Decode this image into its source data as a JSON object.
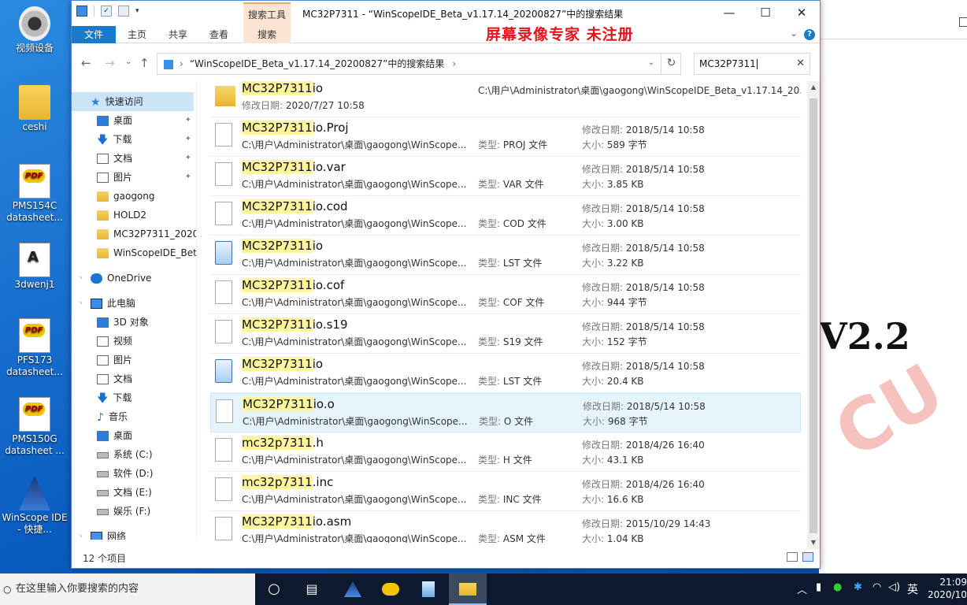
{
  "desktop": {
    "icons": [
      {
        "label": "视频设备",
        "type": "camera"
      },
      {
        "label": "ceshi",
        "type": "folder"
      },
      {
        "label": "PMS154C datasheet...",
        "type": "pdf"
      },
      {
        "label": "3dwenj1",
        "type": "doc"
      },
      {
        "label": "PFS173 datasheet...",
        "type": "pdf"
      },
      {
        "label": "PMS150G datasheet ...",
        "type": "pdf"
      },
      {
        "label": "WinScope IDE - 快捷...",
        "type": "winscope"
      }
    ]
  },
  "right_window": {
    "text": "V2.2"
  },
  "explorer": {
    "title": "MC32P7311 - “WinScopeIDE_Beta_v1.17.14_20200827”中的搜索结果",
    "context_tab": "搜索工具",
    "ribbon_tabs": [
      "文件",
      "主页",
      "共享",
      "查看",
      "搜索"
    ],
    "watermark": "屏幕录像专家  未注册",
    "address": "“WinScopeIDE_Beta_v1.17.14_20200827”中的搜索结果",
    "search_value": "MC32P7311",
    "nav": [
      {
        "label": "快速访问",
        "icon": "star",
        "selected": true,
        "pinned": false
      },
      {
        "label": "桌面",
        "icon": "blue",
        "pinned": true
      },
      {
        "label": "下载",
        "icon": "down",
        "pinned": true
      },
      {
        "label": "文档",
        "icon": "doc",
        "pinned": true
      },
      {
        "label": "图片",
        "icon": "doc",
        "pinned": true
      },
      {
        "label": "gaogong",
        "icon": "folder"
      },
      {
        "label": "HOLD2",
        "icon": "folder"
      },
      {
        "label": "MC32P7311_2020",
        "icon": "folder"
      },
      {
        "label": "WinScopeIDE_Bet",
        "icon": "folder"
      },
      {
        "label": "OneDrive",
        "icon": "cloud"
      },
      {
        "label": "此电脑",
        "icon": "pc"
      },
      {
        "label": "3D 对象",
        "icon": "blue"
      },
      {
        "label": "视频",
        "icon": "doc"
      },
      {
        "label": "图片",
        "icon": "doc"
      },
      {
        "label": "文档",
        "icon": "doc"
      },
      {
        "label": "下载",
        "icon": "down"
      },
      {
        "label": "音乐",
        "icon": "music"
      },
      {
        "label": "桌面",
        "icon": "blue"
      },
      {
        "label": "系统 (C:)",
        "icon": "drive"
      },
      {
        "label": "软件 (D:)",
        "icon": "drive"
      },
      {
        "label": "文档 (E:)",
        "icon": "drive"
      },
      {
        "label": "娱乐 (F:)",
        "icon": "drive"
      },
      {
        "label": "网络",
        "icon": "net"
      }
    ],
    "labels": {
      "type": "类型:",
      "modified": "修改日期:",
      "size": "大小:"
    },
    "files": [
      {
        "hl": "MC32P7311",
        "rest": "io",
        "icon": "folder",
        "path": "C:\\用户\\Administrator\\桌面\\gaogong\\WinScopeIDE_Beta_v1.17.14_20...",
        "type": "",
        "modified": "2020/7/27 10:58",
        "size": "",
        "is_folder": true
      },
      {
        "hl": "MC32P7311",
        "rest": "io.Proj",
        "icon": "file",
        "path": "C:\\用户\\Administrator\\桌面\\gaogong\\WinScope...",
        "type": "PROJ 文件",
        "modified": "2018/5/14 10:58",
        "size": "589 字节"
      },
      {
        "hl": "MC32P7311",
        "rest": "io.var",
        "icon": "file",
        "path": "C:\\用户\\Administrator\\桌面\\gaogong\\WinScope...",
        "type": "VAR 文件",
        "modified": "2018/5/14 10:58",
        "size": "3.85 KB"
      },
      {
        "hl": "MC32P7311",
        "rest": "io.cod",
        "icon": "file",
        "path": "C:\\用户\\Administrator\\桌面\\gaogong\\WinScope...",
        "type": "COD 文件",
        "modified": "2018/5/14 10:58",
        "size": "3.00 KB"
      },
      {
        "hl": "MC32P7311",
        "rest": "io",
        "icon": "notepad",
        "path": "C:\\用户\\Administrator\\桌面\\gaogong\\WinScope...",
        "type": "LST 文件",
        "modified": "2018/5/14 10:58",
        "size": "3.22 KB"
      },
      {
        "hl": "MC32P7311",
        "rest": "io.cof",
        "icon": "file",
        "path": "C:\\用户\\Administrator\\桌面\\gaogong\\WinScope...",
        "type": "COF 文件",
        "modified": "2018/5/14 10:58",
        "size": "944 字节"
      },
      {
        "hl": "MC32P7311",
        "rest": "io.s19",
        "icon": "file",
        "path": "C:\\用户\\Administrator\\桌面\\gaogong\\WinScope...",
        "type": "S19 文件",
        "modified": "2018/5/14 10:58",
        "size": "152 字节"
      },
      {
        "hl": "MC32P7311",
        "rest": "io",
        "icon": "notepad",
        "path": "C:\\用户\\Administrator\\桌面\\gaogong\\WinScope...",
        "type": "LST 文件",
        "modified": "2018/5/14 10:58",
        "size": "20.4 KB"
      },
      {
        "hl": "MC32P7311",
        "rest": "io.o",
        "icon": "file",
        "path": "C:\\用户\\Administrator\\桌面\\gaogong\\WinScope...",
        "type": "O 文件",
        "modified": "2018/5/14 10:58",
        "size": "968 字节",
        "hover": true
      },
      {
        "hl": "mc32p7311",
        "rest": ".h",
        "icon": "file",
        "path": "C:\\用户\\Administrator\\桌面\\gaogong\\WinScope...",
        "type": "H 文件",
        "modified": "2018/4/26 16:40",
        "size": "43.1 KB"
      },
      {
        "hl": "mc32p7311",
        "rest": ".inc",
        "icon": "file",
        "path": "C:\\用户\\Administrator\\桌面\\gaogong\\WinScope...",
        "type": "INC 文件",
        "modified": "2018/4/26 16:40",
        "size": "16.6 KB"
      },
      {
        "hl": "MC32P7311",
        "rest": "io.asm",
        "icon": "file",
        "path": "C:\\用户\\Administrator\\桌面\\gaogong\\WinScope...",
        "type": "ASM 文件",
        "modified": "2015/10/29 14:43",
        "size": "1.04 KB"
      }
    ],
    "status": "12 个项目"
  },
  "taskbar": {
    "search_placeholder": "在这里输入你要搜索的内容",
    "ime": "英",
    "time": "21:09",
    "date": "2020/10/"
  }
}
